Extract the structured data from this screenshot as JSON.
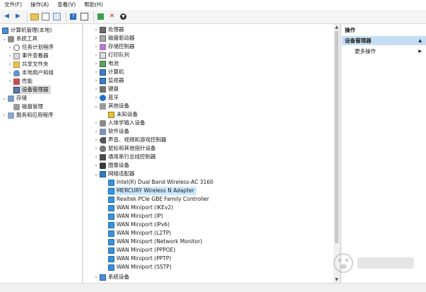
{
  "menu": [
    "文件(F)",
    "操作(A)",
    "查看(V)",
    "帮助(H)"
  ],
  "toolbar": {
    "icons": [
      "back-arrow-icon",
      "forward-arrow-icon",
      "folder-up-icon",
      "properties-icon",
      "details-icon",
      "help-icon",
      "view-pane-icon",
      "driver-icon",
      "delete-x-icon",
      "download-arrow-icon"
    ]
  },
  "left_tree": {
    "root": "计算机管理(本地)",
    "system_tools": "系统工具",
    "task_scheduler": "任务计划程序",
    "event_viewer": "事件查看器",
    "shared_folders": "共享文件夹",
    "local_users": "本地用户和组",
    "performance": "性能",
    "device_manager": "设备管理器",
    "storage": "存储",
    "disk_management": "磁盘管理",
    "services_apps": "服务和应用程序"
  },
  "devices": {
    "processors": "处理器",
    "disk_drives": "磁盘驱动器",
    "storage_controllers": "存储控制器",
    "print_queues": "打印队列",
    "batteries": "电池",
    "computer": "计算机",
    "monitors": "监视器",
    "keyboards": "键盘",
    "bluetooth": "蓝牙",
    "other_devices": "其他设备",
    "unknown_device": "未知设备",
    "hid": "人体学输入设备",
    "software_devices": "软件设备",
    "sound": "声音、视频和游戏控制器",
    "mice": "鼠标和其他指针设备",
    "usb": "通用串行总线控制器",
    "imaging": "图像设备",
    "network_adapters": "网络适配器",
    "adapters": [
      "Intel(R) Dual Band Wireless-AC 3160",
      "MERCURY Wireless N Adapter",
      "Realtek PCIe GBE Family Controller",
      "WAN Miniport (IKEv2)",
      "WAN Miniport (IP)",
      "WAN Miniport (IPv6)",
      "WAN Miniport (L2TP)",
      "WAN Miniport (Network Monitor)",
      "WAN Miniport (PPPOE)",
      "WAN Miniport (PPTP)",
      "WAN Miniport (SSTP)"
    ],
    "system_devices": "系统设备"
  },
  "right_pane": {
    "header": "操作",
    "section": "设备管理器",
    "more_actions": "更多操作"
  },
  "colors": {
    "selection": "#cce8ff",
    "action_section": "#c4ddf4"
  }
}
